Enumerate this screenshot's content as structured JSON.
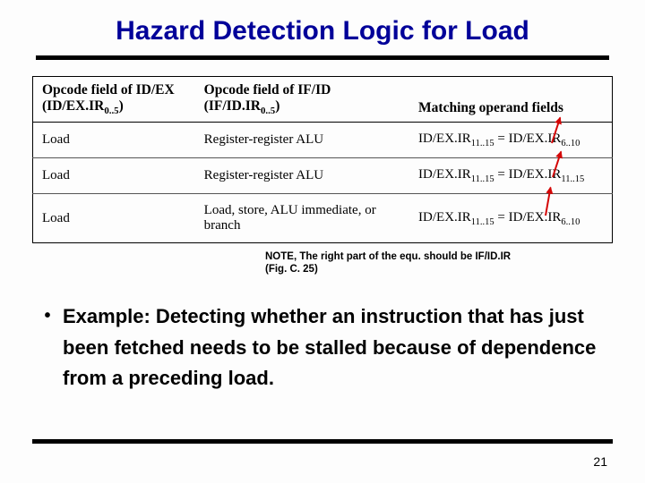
{
  "title": "Hazard Detection Logic for Load",
  "table": {
    "headers": {
      "col1_a": "Opcode field of ID/EX",
      "col1_b_prefix": "(ID/EX.IR",
      "col1_b_sub": "0..5",
      "col1_b_suffix": ")",
      "col2_a": "Opcode field of IF/ID (IF/ID.IR",
      "col2_sub": "0..5",
      "col2_b": ")",
      "col3": "Matching operand fields"
    },
    "rows": [
      {
        "c1": "Load",
        "c2": "Register-register ALU",
        "c3_l": "ID/EX.IR",
        "c3_lsub": "11..15",
        "c3_mid": " = ID/EX.IR",
        "c3_rsub": "6..10"
      },
      {
        "c1": "Load",
        "c2": "Register-register ALU",
        "c3_l": "ID/EX.IR",
        "c3_lsub": "11..15",
        "c3_mid": " = ID/EX.IR",
        "c3_rsub": "11..15"
      },
      {
        "c1": "Load",
        "c2": "Load, store, ALU immediate, or branch",
        "c3_l": "ID/EX.IR",
        "c3_lsub": "11..15",
        "c3_mid": " = ID/EX.IR",
        "c3_rsub": "6..10"
      }
    ]
  },
  "note": {
    "line1": "NOTE, The right part of the equ. should be IF/ID.IR",
    "line2": "(Fig. C. 25)"
  },
  "example": {
    "bullet": "•",
    "text": "Example: Detecting whether an instruction that has just been fetched needs to be stalled because of dependence from a preceding load."
  },
  "page_number": "21"
}
